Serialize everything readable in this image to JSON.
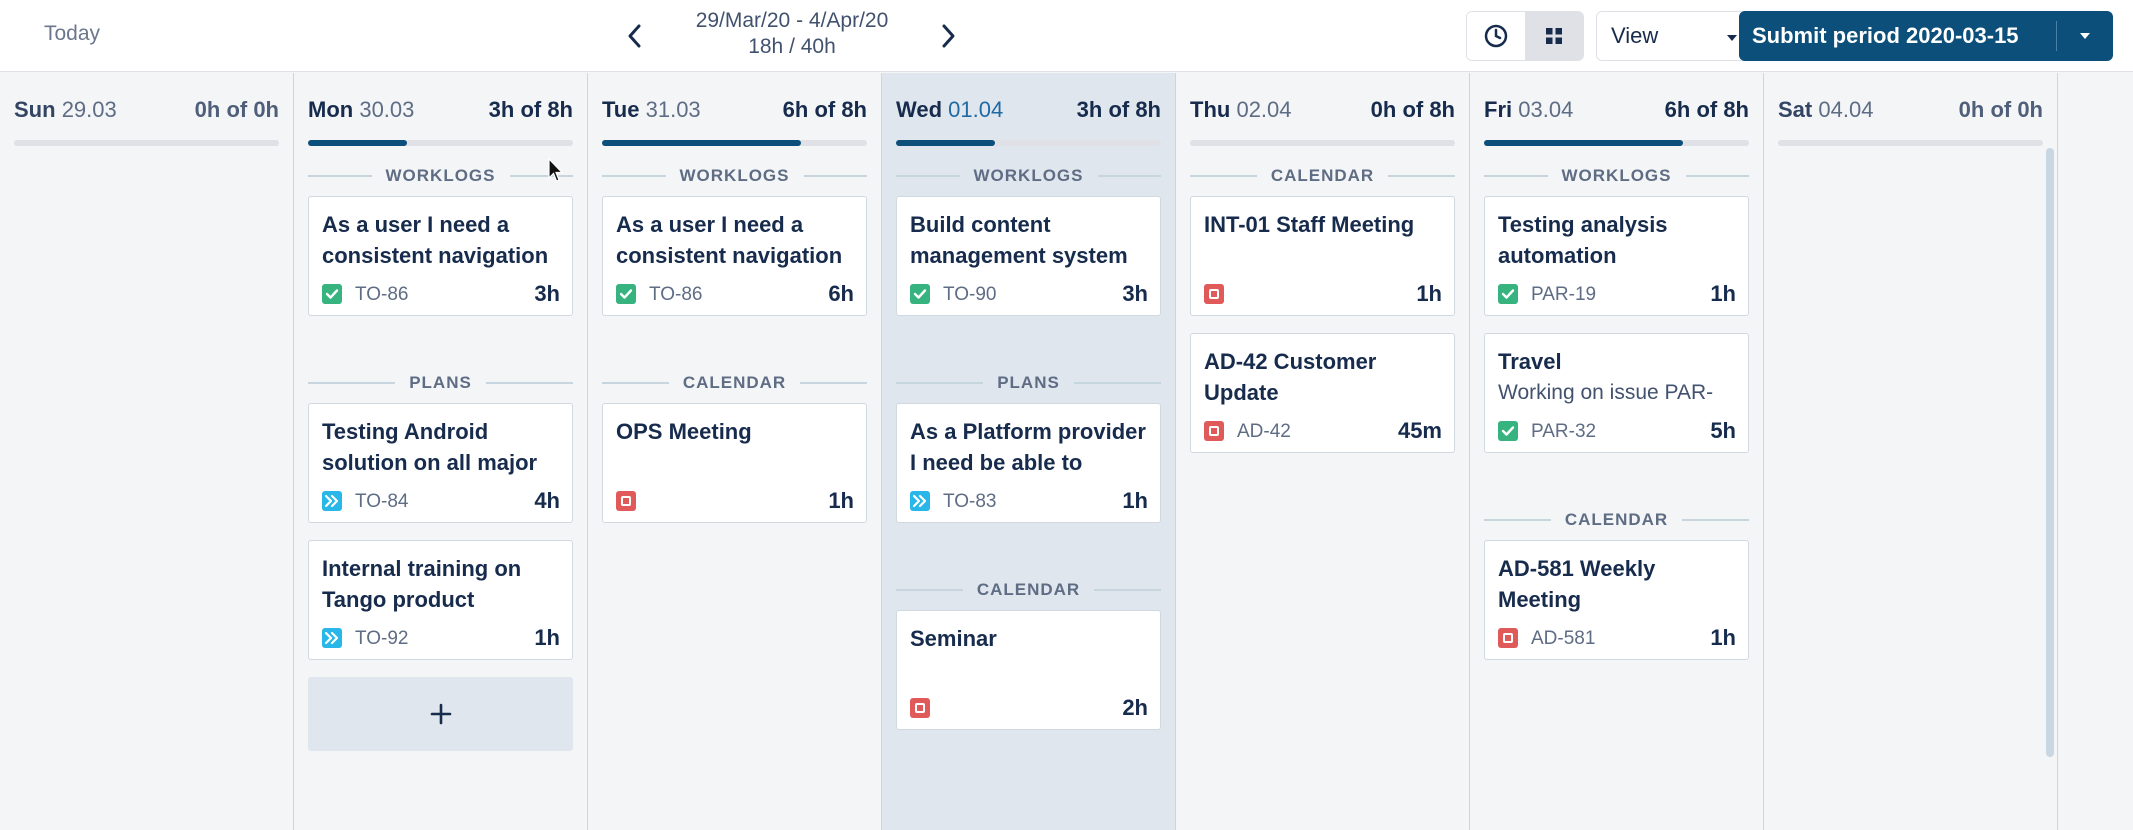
{
  "header": {
    "today_label": "Today",
    "period_range": "29/Mar/20 - 4/Apr/20",
    "period_hours": "18h / 40h",
    "view_label": "View",
    "submit_label": "Submit period 2020-03-15",
    "icons": {
      "prev": "chevron-left-icon",
      "next": "chevron-right-icon",
      "clock": "clock-icon",
      "grid": "grid-icon",
      "dropdown": "caret-down-icon"
    }
  },
  "colors": {
    "primary": "#0b4f7a",
    "story": "#36b37e",
    "plan": "#29b6e8",
    "calendar": "#e05a5a",
    "today_bg": "#dfe6ee"
  },
  "days": [
    {
      "dow": "Sun",
      "date": "29.03",
      "hours": "0h of 0h",
      "progress": 0,
      "sections": []
    },
    {
      "dow": "Mon",
      "date": "30.03",
      "hours": "3h of 8h",
      "progress": 0.375,
      "sections": [
        {
          "label": "WORKLOGS",
          "cards": [
            {
              "title": "As a user I need a consistent navigation",
              "sub": "",
              "type": "story",
              "key": "TO-86",
              "dur": "3h"
            }
          ]
        },
        {
          "label": "PLANS",
          "cards": [
            {
              "title": "Testing Android solution on all major",
              "sub": "",
              "type": "plan",
              "key": "TO-84",
              "dur": "4h"
            },
            {
              "title": "Internal training on Tango product",
              "sub": "",
              "type": "plan",
              "key": "TO-92",
              "dur": "1h"
            }
          ]
        }
      ],
      "add_label": "+"
    },
    {
      "dow": "Tue",
      "date": "31.03",
      "hours": "6h of 8h",
      "progress": 0.75,
      "sections": [
        {
          "label": "WORKLOGS",
          "cards": [
            {
              "title": "As a user I need a consistent navigation",
              "sub": "",
              "type": "story",
              "key": "TO-86",
              "dur": "6h"
            }
          ]
        },
        {
          "label": "CALENDAR",
          "cards": [
            {
              "title": "OPS Meeting",
              "sub": "",
              "type": "cal",
              "key": "",
              "dur": "1h"
            }
          ]
        }
      ]
    },
    {
      "dow": "Wed",
      "date": "01.04",
      "hours": "3h of 8h",
      "progress": 0.375,
      "sections": [
        {
          "label": "WORKLOGS",
          "cards": [
            {
              "title": "Build content management system",
              "sub": "",
              "type": "story",
              "key": "TO-90",
              "dur": "3h"
            }
          ]
        },
        {
          "label": "PLANS",
          "cards": [
            {
              "title": "As a Platform provider I need be able to",
              "sub": "",
              "type": "plan",
              "key": "TO-83",
              "dur": "1h"
            }
          ]
        },
        {
          "label": "CALENDAR",
          "cards": [
            {
              "title": "Seminar",
              "sub": "",
              "type": "cal",
              "key": "",
              "dur": "2h"
            }
          ]
        }
      ]
    },
    {
      "dow": "Thu",
      "date": "02.04",
      "hours": "0h of 8h",
      "progress": 0,
      "sections": [
        {
          "label": "CALENDAR",
          "cards": [
            {
              "title": "INT-01 Staff Meeting",
              "sub": "",
              "type": "cal",
              "key": "",
              "dur": "1h"
            },
            {
              "title": "AD-42 Customer Update",
              "sub": "",
              "type": "cal",
              "key": "AD-42",
              "dur": "45m"
            }
          ]
        }
      ]
    },
    {
      "dow": "Fri",
      "date": "03.04",
      "hours": "6h of 8h",
      "progress": 0.75,
      "sections": [
        {
          "label": "WORKLOGS",
          "cards": [
            {
              "title": "Testing analysis automation",
              "sub": "",
              "type": "story",
              "key": "PAR-19",
              "dur": "1h"
            },
            {
              "title": "Travel",
              "sub": "Working on issue PAR-",
              "type": "story",
              "key": "PAR-32",
              "dur": "5h"
            }
          ]
        },
        {
          "label": "CALENDAR",
          "cards": [
            {
              "title": "AD-581 Weekly Meeting",
              "sub": "",
              "type": "cal",
              "key": "AD-581",
              "dur": "1h"
            }
          ]
        }
      ]
    },
    {
      "dow": "Sat",
      "date": "04.04",
      "hours": "0h of 0h",
      "progress": 0,
      "sections": []
    }
  ]
}
